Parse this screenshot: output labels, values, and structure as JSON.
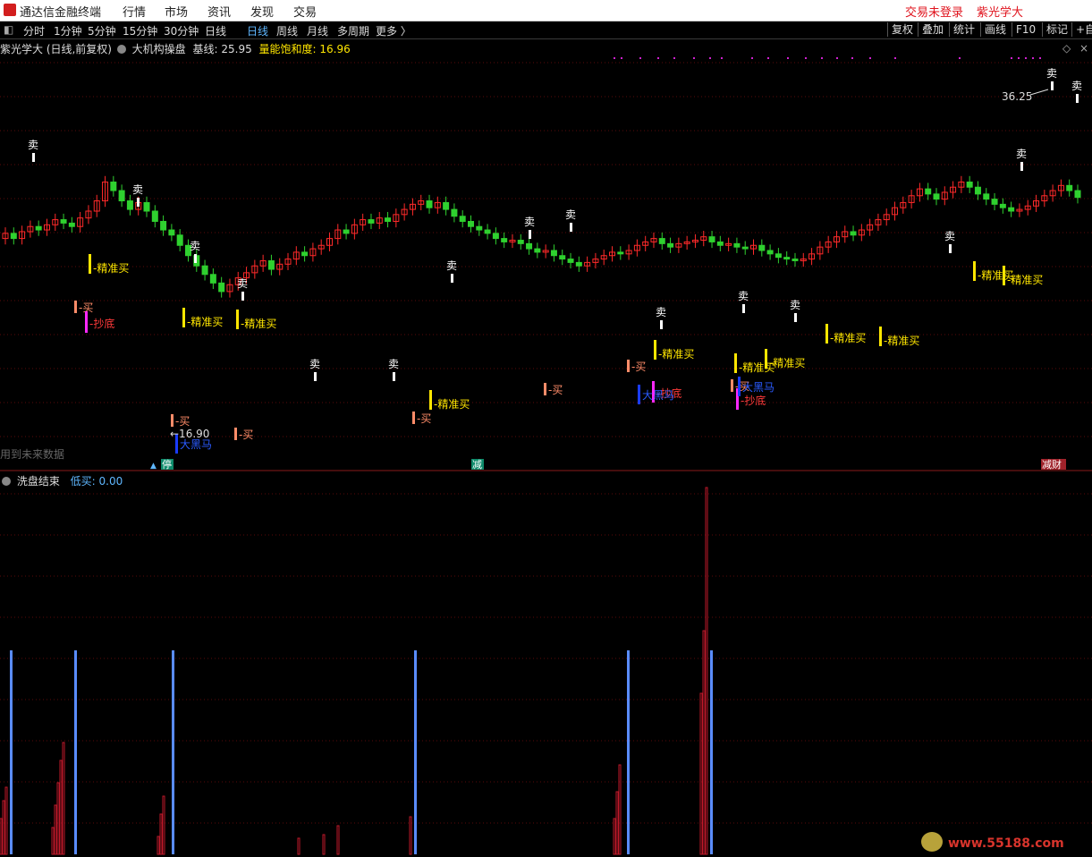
{
  "titlebar": {
    "app_name": "通达信金融终端",
    "menu": [
      "行情",
      "市场",
      "资讯",
      "发现",
      "交易"
    ],
    "right": [
      "交易未登录",
      "紫光学大"
    ]
  },
  "toolbar": {
    "periods": [
      "分时",
      "1分钟",
      "5分钟",
      "15分钟",
      "30分钟",
      "日线",
      "周线",
      "月线",
      "多周期",
      "更多 〉"
    ],
    "active_period": "日线",
    "right_buttons": [
      "复权",
      "叠加",
      "统计",
      "画线",
      "F10",
      "标记",
      "+自"
    ]
  },
  "main_panel": {
    "stock_title": "紫光学大 (日线,前复权)",
    "indicator_name": "大机构操盘",
    "baseline_label": "基线: 25.95",
    "saturation_label": "量能饱和度: 16.96",
    "high_price": "36.25",
    "low_price": "16.90",
    "future_data_note": "用到未来数据",
    "bottom_tags": [
      "停",
      "减",
      "减财"
    ],
    "signals": {
      "sell": "卖",
      "buy": "买",
      "precise_buy": "精准买",
      "bottom_fish": "抄底",
      "dark_horse": "大黑马"
    }
  },
  "sub_panel": {
    "indicator_name": "洗盘结束",
    "low_buy_label": "低买: 0.00"
  },
  "footer": {
    "url": "www.55188.com"
  },
  "colors": {
    "up": "#ff2a2a",
    "down": "#2fd12f",
    "sell_marker": "#ffffff",
    "precise_buy": "#ffe600",
    "bottom_fish": "#ff28ff",
    "dark_horse": "#1a3cff",
    "buy": "#ff8c69",
    "wash_blue": "#5a8cff",
    "wash_red": "#c0192a"
  },
  "chart_data": {
    "type": "candlestick",
    "price_range": [
      15,
      38
    ],
    "closes": [
      27.5,
      27.2,
      27.6,
      27.9,
      27.7,
      28.0,
      28.3,
      28.1,
      27.9,
      28.4,
      28.8,
      29.4,
      30.5,
      30.0,
      29.4,
      28.9,
      29.3,
      28.8,
      28.2,
      27.7,
      27.4,
      26.8,
      26.2,
      25.6,
      25.1,
      24.6,
      24.1,
      24.5,
      24.9,
      25.2,
      25.6,
      25.9,
      25.4,
      25.7,
      26.0,
      26.4,
      26.2,
      26.6,
      26.8,
      27.2,
      27.7,
      27.5,
      28.0,
      28.3,
      28.1,
      28.4,
      28.2,
      28.6,
      28.9,
      29.2,
      29.4,
      29.0,
      29.3,
      28.9,
      28.5,
      28.2,
      27.9,
      27.7,
      27.5,
      27.2,
      27.0,
      27.1,
      26.9,
      26.6,
      26.4,
      26.5,
      26.2,
      26.0,
      25.8,
      25.6,
      25.8,
      26.0,
      26.2,
      26.4,
      26.3,
      26.5,
      26.8,
      27.0,
      27.2,
      26.9,
      26.7,
      26.9,
      27.0,
      27.1,
      27.3,
      27.0,
      26.8,
      26.9,
      26.7,
      26.6,
      26.8,
      26.5,
      26.3,
      26.1,
      26.0,
      25.9,
      26.0,
      26.3,
      26.7,
      27.0,
      27.3,
      27.6,
      27.4,
      27.7,
      28.0,
      28.3,
      28.6,
      29.0,
      29.3,
      29.7,
      30.1,
      29.8,
      29.5,
      29.9,
      30.2,
      30.5,
      30.2,
      29.8,
      29.5,
      29.2,
      29.0,
      28.8,
      28.9,
      29.1,
      29.4,
      29.7,
      30.0,
      30.3,
      30.0,
      29.6
    ],
    "wash_blue_spikes": [
      12,
      84,
      193,
      464,
      702,
      795
    ],
    "wash_red_peak": 790
  }
}
